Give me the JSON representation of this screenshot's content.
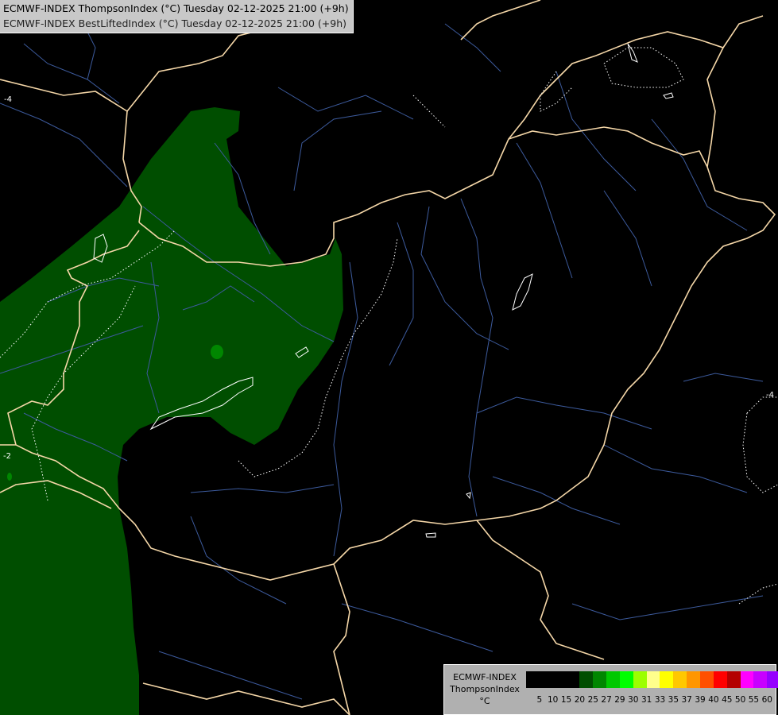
{
  "title": {
    "line1": "ECMWF-INDEX ThompsonIndex (°C) Tuesday 02-12-2025 21:00 (+9h)",
    "line2": "ECMWF-INDEX BestLiftedIndex (°C) Tuesday 02-12-2025 21:00 (+9h)"
  },
  "legend": {
    "model": "ECMWF-INDEX",
    "parameter": "ThompsonIndex",
    "unit": "°C",
    "colors": [
      "#000000",
      "#000000",
      "#000000",
      "#000000",
      "#004e00",
      "#008600",
      "#00c800",
      "#00ff00",
      "#9cff00",
      "#ffff8c",
      "#ffff00",
      "#ffc800",
      "#ff9600",
      "#ff5000",
      "#ff0000",
      "#b40000",
      "#ff00ff",
      "#c800ff",
      "#9600ff",
      "#5000ff",
      "#0000ff"
    ],
    "ticks": [
      "5",
      "10",
      "15",
      "20",
      "25",
      "27",
      "29",
      "30",
      "31",
      "33",
      "35",
      "37",
      "39",
      "40",
      "45",
      "50",
      "55",
      "60"
    ]
  },
  "isoline_labels": [
    "-4",
    "-4",
    "-2"
  ],
  "map_colors": {
    "background": "#000000",
    "fill_20_25": "#004e00",
    "fill_25_27": "#008600",
    "border": "#f5d7a8",
    "rivers": "#3c5a9c",
    "lifted_index": "#ffffff"
  }
}
